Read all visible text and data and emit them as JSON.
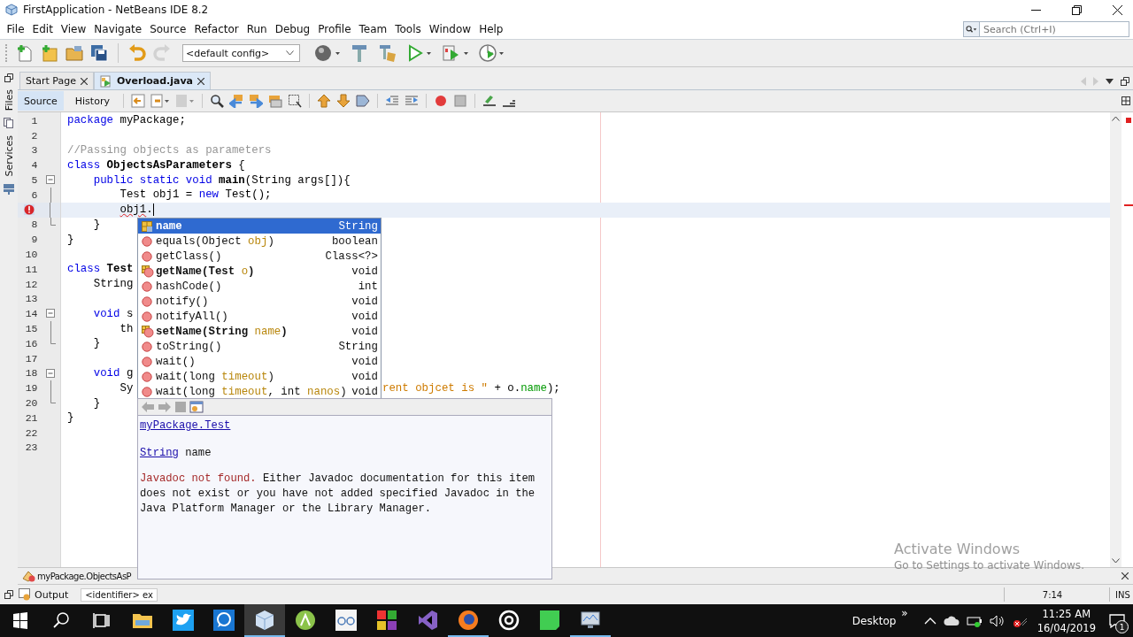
{
  "window": {
    "title": "FirstApplication - NetBeans IDE 8.2"
  },
  "menu": [
    "File",
    "Edit",
    "View",
    "Navigate",
    "Source",
    "Refactor",
    "Run",
    "Debug",
    "Profile",
    "Team",
    "Tools",
    "Window",
    "Help"
  ],
  "search": {
    "placeholder": "Search (Ctrl+I)"
  },
  "toolbar": {
    "config": "<default config>",
    "buttons": [
      {
        "disabled": false
      },
      {
        "disabled": false
      },
      {
        "disabled": false
      },
      {
        "disabled": false
      },
      {
        "disabled": false
      },
      {
        "disabled": true
      }
    ]
  },
  "side_tabs": [
    "Files",
    "Services"
  ],
  "editor_tabs": [
    {
      "label": "Start Page",
      "selected": false
    },
    {
      "label": "Overload.java",
      "selected": true
    }
  ],
  "view_tabs": [
    {
      "label": "Source",
      "selected": true
    },
    {
      "label": "History",
      "selected": false
    }
  ],
  "code": {
    "lines": [
      {
        "number": "1",
        "error": false,
        "current": false,
        "segments": [
          {
            "text": "package",
            "kind": "kw"
          },
          {
            "text": " myPackage;",
            "kind": "plain"
          }
        ]
      },
      {
        "number": "2",
        "error": false,
        "current": false
      },
      {
        "number": "3",
        "error": false,
        "current": false,
        "segments": [
          {
            "text": "//Passing objects as parameters",
            "kind": "comment"
          }
        ]
      },
      {
        "number": "4",
        "error": false,
        "current": false,
        "segments": [
          {
            "text": "class",
            "kind": "kw"
          },
          {
            "text": " ObjectsAsParameters",
            "kind": "bold"
          },
          {
            "text": " {",
            "kind": "plain"
          }
        ],
        "children": [
          {
            "number": "5",
            "error": false,
            "current": false,
            "expanded": true,
            "segments": [
              {
                "text": "public static void",
                "kind": "kw"
              },
              {
                "text": " main",
                "kind": "bold"
              },
              {
                "text": "(String args[]){",
                "kind": "plain"
              }
            ],
            "children": [
              {
                "number": "6",
                "error": false,
                "current": false,
                "segments": [
                  {
                    "text": "Test obj1 = ",
                    "kind": "plain"
                  },
                  {
                    "text": "new",
                    "kind": "kw"
                  },
                  {
                    "text": " Test();",
                    "kind": "plain"
                  }
                ]
              },
              {
                "error": true,
                "current": true,
                "segments": [
                  {
                    "text": "obj1",
                    "kind": "err"
                  },
                  {
                    "text": ".",
                    "kind": "plain"
                  }
                ]
              }
            ],
            "close": {
              "number": "8",
              "error": false,
              "current": false,
              "segments": [
                {
                  "text": "}",
                  "kind": "plain"
                }
              ]
            }
          }
        ],
        "close": {
          "number": "9",
          "error": false,
          "current": false,
          "segments": [
            {
              "text": "}",
              "kind": "plain"
            }
          ]
        }
      },
      {
        "number": "10",
        "error": false,
        "current": false
      },
      {
        "number": "11",
        "error": false,
        "current": false,
        "segments": [
          {
            "text": "class",
            "kind": "kw"
          },
          {
            "text": " Test",
            "kind": "bold"
          }
        ],
        "children": [
          {
            "number": "12",
            "error": false,
            "current": false,
            "segments": [
              {
                "text": "String",
                "kind": "plain"
              }
            ]
          },
          {
            "number": "13",
            "error": false,
            "current": false
          },
          {
            "number": "14",
            "error": false,
            "current": false,
            "expanded": true,
            "segments": [
              {
                "text": "void",
                "kind": "kw"
              },
              {
                "text": " s",
                "kind": "plain"
              }
            ],
            "children": [
              {
                "number": "15",
                "error": false,
                "current": false,
                "segments": [
                  {
                    "text": "th",
                    "kind": "plain"
                  }
                ]
              }
            ],
            "close": {
              "number": "16",
              "error": false,
              "current": false,
              "segments": [
                {
                  "text": "}",
                  "kind": "plain"
                }
              ]
            }
          },
          {
            "number": "17",
            "error": false,
            "current": false
          },
          {
            "number": "18",
            "error": false,
            "current": false,
            "expanded": true,
            "segments": [
              {
                "text": "void",
                "kind": "kw"
              },
              {
                "text": " g",
                "kind": "plain"
              }
            ],
            "children": [
              {
                "number": "19",
                "error": false,
                "current": false,
                "segments": [
                  {
                    "text": "Sy",
                    "kind": "plain"
                  }
                ],
                "after_popup": [
                  {
                    "text": "rent objcet is \"",
                    "kind": "string"
                  },
                  {
                    "text": " + o.",
                    "kind": "plain"
                  },
                  {
                    "text": "name",
                    "kind": "field"
                  },
                  {
                    "text": ");",
                    "kind": "plain"
                  }
                ]
              }
            ],
            "close": {
              "number": "20",
              "error": false,
              "current": false,
              "segments": [
                {
                  "text": "}",
                  "kind": "plain"
                }
              ]
            }
          }
        ],
        "close": {
          "number": "21",
          "error": false,
          "current": false,
          "segments": [
            {
              "text": "}",
              "kind": "plain"
            }
          ]
        }
      },
      {
        "number": "22",
        "error": false,
        "current": false
      },
      {
        "number": "23",
        "error": false,
        "current": false
      }
    ]
  },
  "completion": {
    "items": [
      {
        "kind": "field",
        "selected": true,
        "label": [
          {
            "text": "name",
            "kind": "plain"
          }
        ],
        "type": "String"
      },
      {
        "kind": "inherited",
        "selected": false,
        "label": [
          {
            "text": "equals(Object ",
            "kind": "plain"
          },
          {
            "text": "obj",
            "kind": "param"
          },
          {
            "text": ")",
            "kind": "plain"
          }
        ],
        "type": "boolean"
      },
      {
        "kind": "inherited",
        "selected": false,
        "label": [
          {
            "text": "getClass()",
            "kind": "plain"
          }
        ],
        "type": "Class<?>"
      },
      {
        "kind": "member",
        "selected": false,
        "label": [
          {
            "text": "getName(Test ",
            "kind": "plain"
          },
          {
            "text": "o",
            "kind": "param"
          },
          {
            "text": ")",
            "kind": "plain"
          }
        ],
        "type": "void"
      },
      {
        "kind": "inherited",
        "selected": false,
        "label": [
          {
            "text": "hashCode()",
            "kind": "plain"
          }
        ],
        "type": "int"
      },
      {
        "kind": "inherited",
        "selected": false,
        "label": [
          {
            "text": "notify()",
            "kind": "plain"
          }
        ],
        "type": "void"
      },
      {
        "kind": "inherited",
        "selected": false,
        "label": [
          {
            "text": "notifyAll()",
            "kind": "plain"
          }
        ],
        "type": "void"
      },
      {
        "kind": "member",
        "selected": false,
        "label": [
          {
            "text": "setName(String ",
            "kind": "plain"
          },
          {
            "text": "name",
            "kind": "param"
          },
          {
            "text": ")",
            "kind": "plain"
          }
        ],
        "type": "void"
      },
      {
        "kind": "inherited",
        "selected": false,
        "label": [
          {
            "text": "toString()",
            "kind": "plain"
          }
        ],
        "type": "String"
      },
      {
        "kind": "inherited",
        "selected": false,
        "label": [
          {
            "text": "wait()",
            "kind": "plain"
          }
        ],
        "type": "void"
      },
      {
        "kind": "inherited",
        "selected": false,
        "label": [
          {
            "text": "wait(long ",
            "kind": "plain"
          },
          {
            "text": "timeout",
            "kind": "param"
          },
          {
            "text": ")",
            "kind": "plain"
          }
        ],
        "type": "void"
      },
      {
        "kind": "inherited",
        "selected": false,
        "label": [
          {
            "text": "wait(long ",
            "kind": "plain"
          },
          {
            "text": "timeout",
            "kind": "param"
          },
          {
            "text": ", int ",
            "kind": "plain"
          },
          {
            "text": "nanos",
            "kind": "param"
          },
          {
            "text": ")",
            "kind": "plain"
          }
        ],
        "type": "void"
      }
    ]
  },
  "javadoc": {
    "class_link": "myPackage.Test",
    "signature_type": "String",
    "signature_name": "name",
    "message": [
      {
        "text": "Javadoc not found.",
        "kind": "error"
      },
      {
        "text": " Either Javadoc documentation for this item does not exist or you have not added specified Javadoc in the Java Platform Manager or the Library Manager.",
        "kind": "plain"
      }
    ]
  },
  "navigator": {
    "path": "myPackage.ObjectsAsP"
  },
  "output": {
    "tab": "Output",
    "field": "<identifier> ex"
  },
  "status": {
    "position": "7:14",
    "mode": "INS"
  },
  "activation": {
    "title": "Activate Windows",
    "hint": "Go to Settings to activate Windows."
  },
  "taskbar": {
    "apps": [
      {
        "running": false,
        "active": false
      },
      {
        "running": false,
        "active": false
      },
      {
        "running": false,
        "active": false
      },
      {
        "running": true,
        "active": true
      },
      {
        "running": false,
        "active": false
      },
      {
        "running": false,
        "active": false
      },
      {
        "running": false,
        "active": false
      },
      {
        "running": false,
        "active": false
      },
      {
        "running": true,
        "active": false
      },
      {
        "running": false,
        "active": false
      },
      {
        "running": false,
        "active": false
      },
      {
        "running": true,
        "active": false
      }
    ],
    "desktop": "Desktop",
    "more": "»",
    "time": "11:25 AM",
    "date": "16/04/2019",
    "notifications": "1"
  }
}
